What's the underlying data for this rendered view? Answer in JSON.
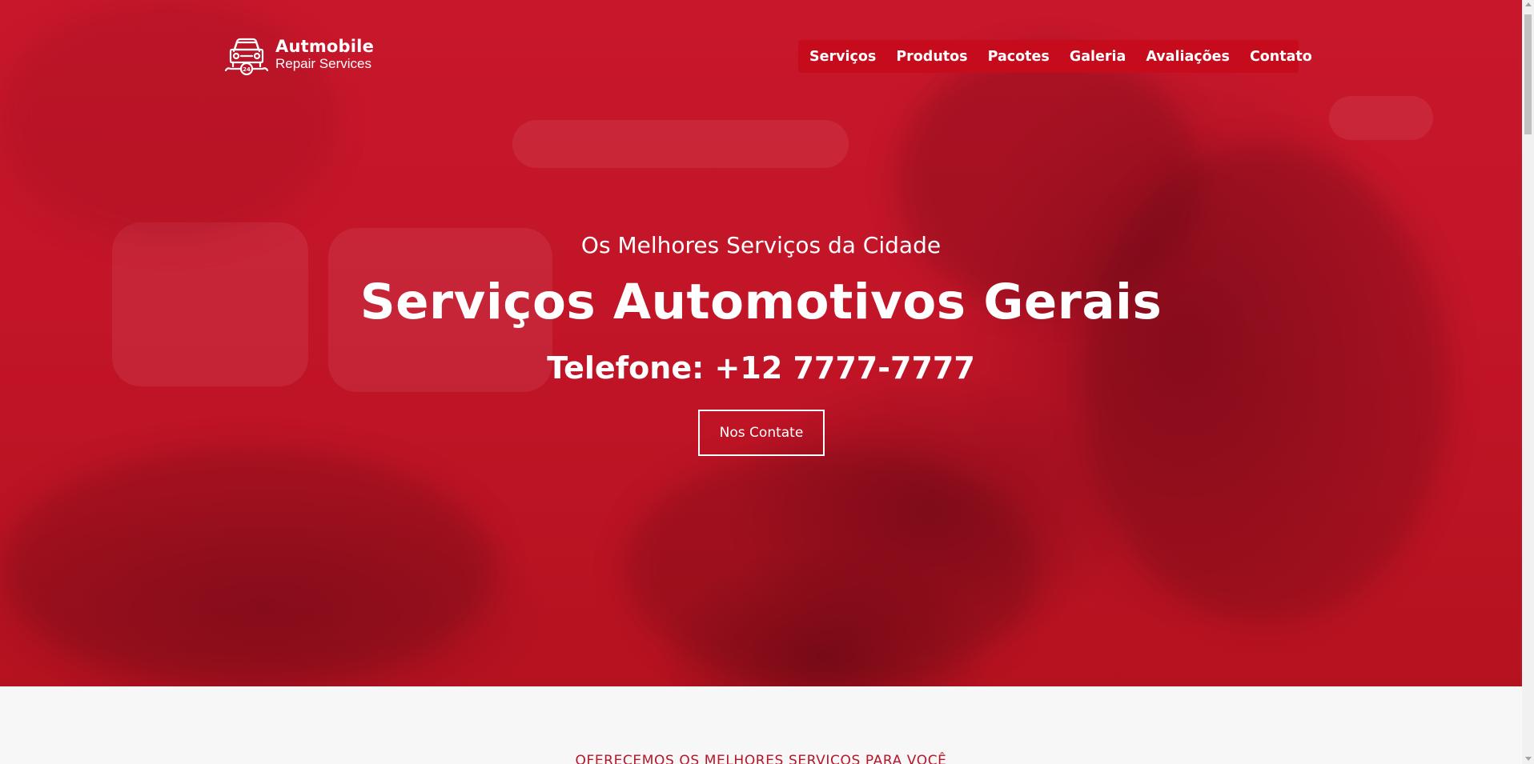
{
  "brand": {
    "title": "Autmobile",
    "subtitle": "Repair Services",
    "icon": "car-repair-icon",
    "logo_badge": "24"
  },
  "nav": {
    "items": [
      {
        "label": "Serviços"
      },
      {
        "label": "Produtos"
      },
      {
        "label": "Pacotes"
      },
      {
        "label": "Galeria"
      },
      {
        "label": "Avaliações"
      },
      {
        "label": "Contato"
      }
    ]
  },
  "hero": {
    "eyebrow": "Os Melhores Serviços da Cidade",
    "headline": "Serviços Automotivos Gerais",
    "phone": "Telefone: +12 7777-7777",
    "cta_label": "Nos Contate"
  },
  "services_section": {
    "title": "OFERECEMOS OS MELHORES SERVIÇOS PARA VOCÊ"
  },
  "colors": {
    "brand_red": "#c8172b",
    "nav_bg": "#c60b1d",
    "section_title": "#b3172a",
    "section_bg": "#f7f7f7"
  }
}
